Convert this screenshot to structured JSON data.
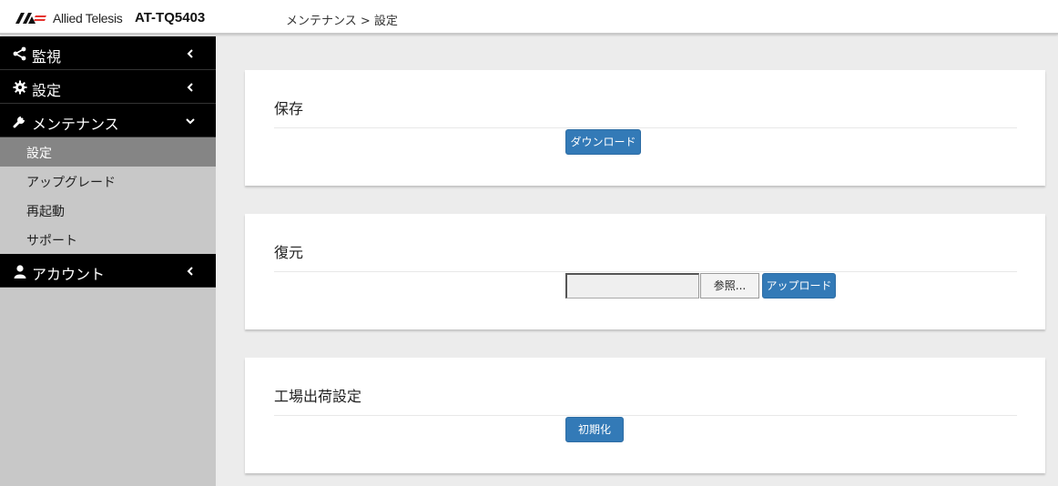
{
  "header": {
    "brand": "Allied Telesis",
    "model": "AT-TQ5403",
    "breadcrumb": "メンテナンス > 設定"
  },
  "sidebar": {
    "items": [
      {
        "label": "監視",
        "icon": "share-icon",
        "expanded": false
      },
      {
        "label": "設定",
        "icon": "gear-icon",
        "expanded": false
      },
      {
        "label": "メンテナンス",
        "icon": "wrench-icon",
        "expanded": true,
        "children": [
          {
            "label": "設定",
            "active": true
          },
          {
            "label": "アップグレード",
            "active": false
          },
          {
            "label": "再起動",
            "active": false
          },
          {
            "label": "サポート",
            "active": false
          }
        ]
      },
      {
        "label": "アカウント",
        "icon": "user-icon",
        "expanded": false
      }
    ]
  },
  "main": {
    "save": {
      "title": "保存",
      "download_label": "ダウンロード"
    },
    "restore": {
      "title": "復元",
      "file_value": "",
      "browse_label": "参照...",
      "upload_label": "アップロード"
    },
    "factory": {
      "title": "工場出荷設定",
      "reset_label": "初期化"
    }
  },
  "colors": {
    "accent": "#337ab7",
    "nav_bg": "#000000",
    "sidebar_bg": "#c8c8c8",
    "active_bg": "#858585",
    "logo_red": "#e5322d"
  }
}
